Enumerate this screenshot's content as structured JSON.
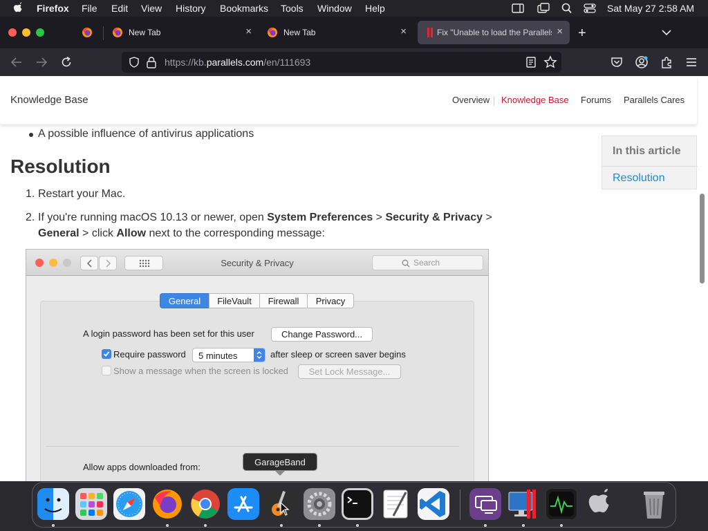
{
  "menubar": {
    "app_name": "Firefox",
    "items": [
      "File",
      "Edit",
      "View",
      "History",
      "Bookmarks",
      "Tools",
      "Window",
      "Help"
    ],
    "clock": "Sat May 27  2:58 AM"
  },
  "tabs": [
    {
      "label": ""
    },
    {
      "label": "New Tab"
    },
    {
      "label": "New Tab"
    },
    {
      "label": "Fix \"Unable to load the Parallels"
    }
  ],
  "urlbar": {
    "prefix": "https://kb.",
    "domain": "parallels.com",
    "path": "/en/111693"
  },
  "site": {
    "title": "Knowledge Base",
    "nav": [
      "Overview",
      "Knowledge Base",
      "Forums",
      "Parallels Cares"
    ]
  },
  "article": {
    "bullet": "A possible influence of antivirus applications",
    "heading": "Resolution",
    "step1_num": "1.",
    "step1": "Restart your Mac.",
    "step2_num": "2.",
    "step2": {
      "a": "If you're running macOS 10.13 or newer, open ",
      "b": "System Preferences",
      "c": " > ",
      "d": "Security & Privacy",
      "e": " >",
      "f": "General",
      "g": " > click ",
      "h": "Allow",
      "i": " next to the corresponding message:"
    }
  },
  "screenshot": {
    "title": "Security & Privacy",
    "search_placeholder": "Search",
    "tabs": [
      "General",
      "FileVault",
      "Firewall",
      "Privacy"
    ],
    "selected_tab": "General",
    "login_text": "A login password has been set for this user",
    "change_password": "Change Password...",
    "require_password": "Require password",
    "require_checked": true,
    "delay": "5 minutes",
    "after_text": "after sleep or screen saver begins",
    "show_message": "Show a message when the screen is locked",
    "set_lock": "Set Lock Message...",
    "allow_apps": "Allow apps downloaded from:"
  },
  "sidebar": {
    "heading": "In this article",
    "link": "Resolution"
  },
  "tooltip": "GarageBand",
  "dock": {
    "apps": [
      "Finder",
      "Launchpad",
      "Safari",
      "Firefox",
      "Google Chrome",
      "App Store",
      "GarageBand",
      "System Preferences",
      "Terminal",
      "TextEdit",
      "Visual Studio Code",
      "Parallels Desktop",
      "Parallels Desktop",
      "Activity Monitor",
      "Boot Camp Assistant",
      "Trash"
    ]
  },
  "colors": {
    "accent": "#d0142c",
    "link": "#1a8ad8",
    "selected_segment": "#3f86e4"
  }
}
